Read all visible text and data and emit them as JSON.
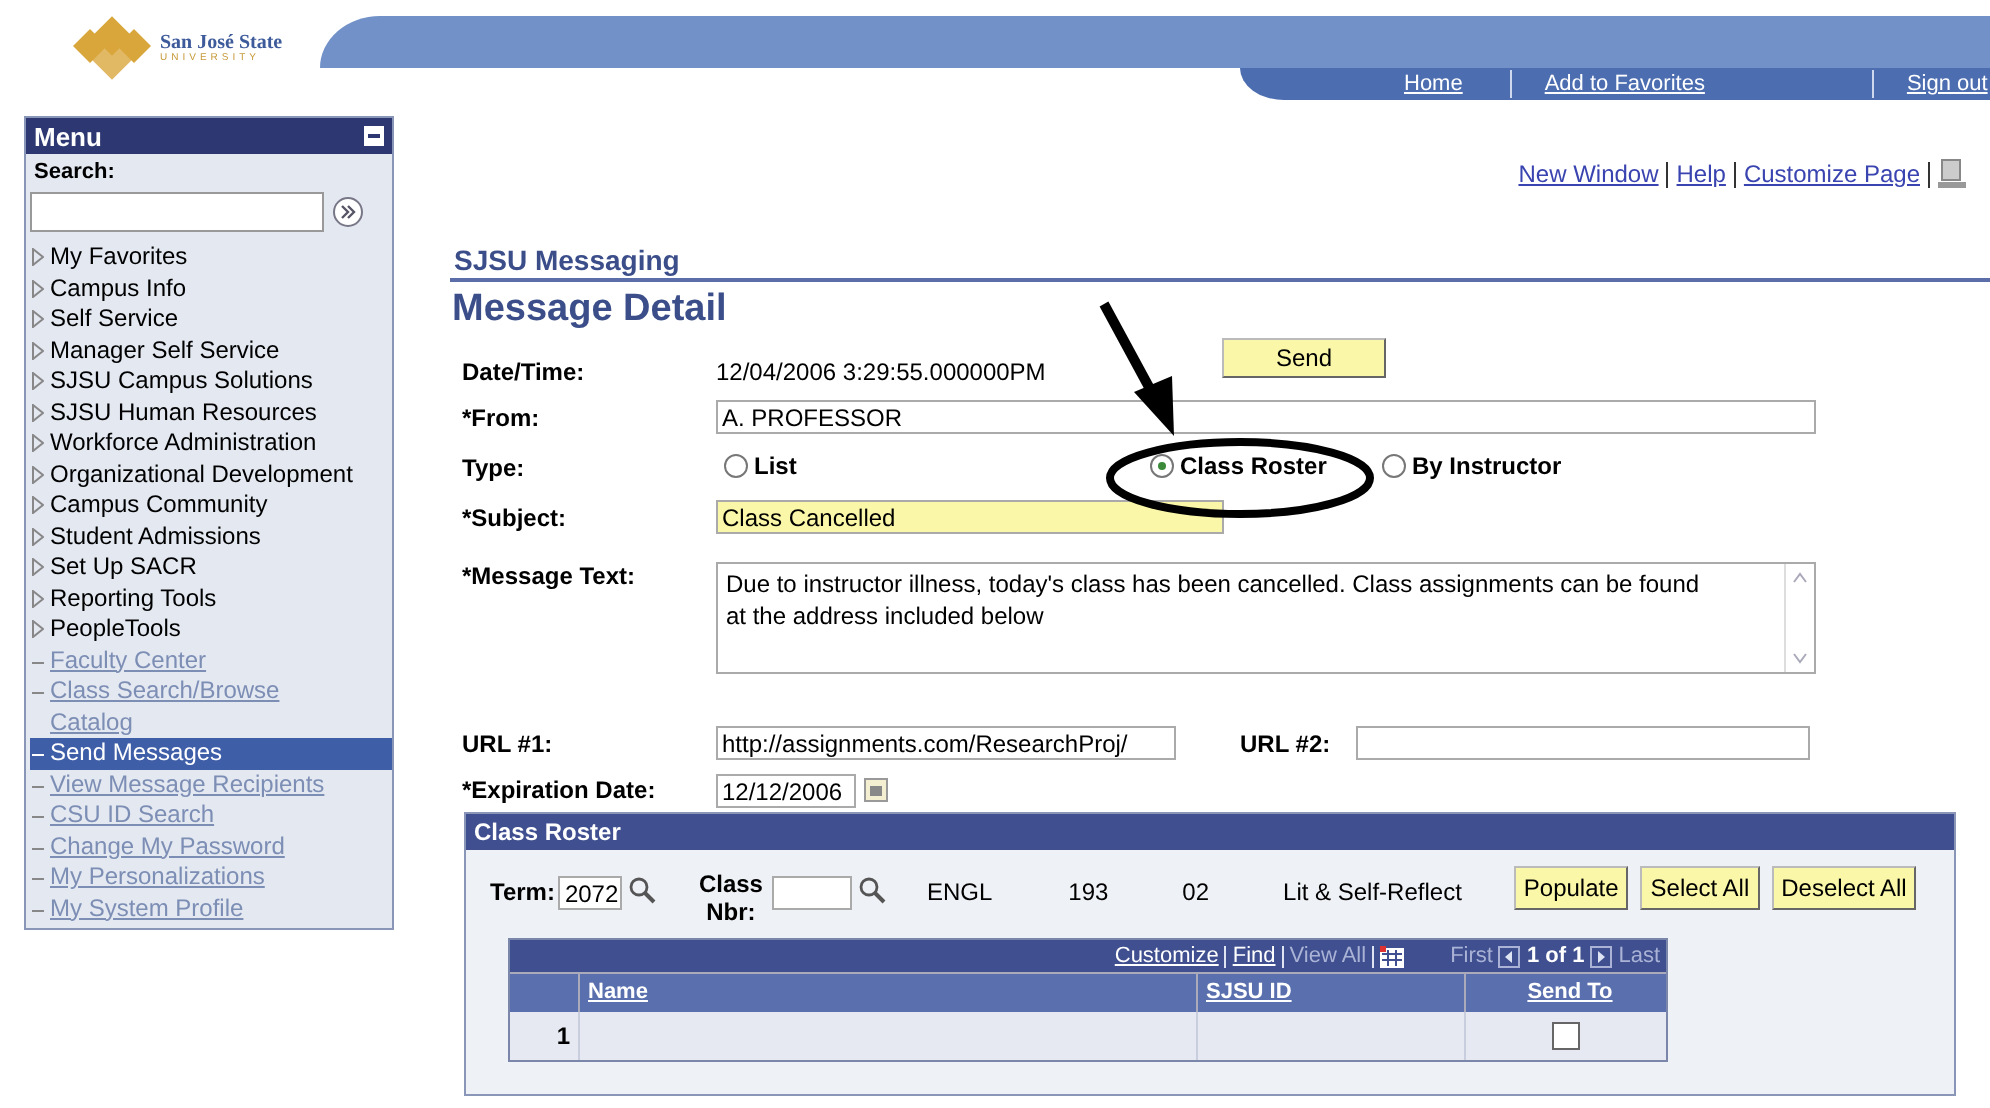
{
  "header": {
    "logo": {
      "name": "San José State",
      "subtitle": "UNIVERSITY"
    },
    "nav_links": [
      "Home",
      "Add to Favorites",
      "Sign out"
    ]
  },
  "menu": {
    "title": "Menu",
    "search_label": "Search:",
    "items": [
      {
        "label": "My Favorites",
        "kind": "folder",
        "selected": false
      },
      {
        "label": "Campus Info",
        "kind": "folder",
        "selected": false
      },
      {
        "label": "Self Service",
        "kind": "folder",
        "selected": false
      },
      {
        "label": "Manager Self Service",
        "kind": "folder",
        "selected": false
      },
      {
        "label": "SJSU Campus Solutions",
        "kind": "folder",
        "selected": false
      },
      {
        "label": "SJSU Human Resources",
        "kind": "folder",
        "selected": false
      },
      {
        "label": "Workforce Administration",
        "kind": "folder",
        "selected": false
      },
      {
        "label": "Organizational Development",
        "kind": "folder",
        "selected": false
      },
      {
        "label": "Campus Community",
        "kind": "folder",
        "selected": false
      },
      {
        "label": "Student Admissions",
        "kind": "folder",
        "selected": false
      },
      {
        "label": "Set Up SACR",
        "kind": "folder",
        "selected": false
      },
      {
        "label": "Reporting Tools",
        "kind": "folder",
        "selected": false
      },
      {
        "label": "PeopleTools",
        "kind": "folder",
        "selected": false
      },
      {
        "label": "Faculty Center",
        "kind": "link",
        "selected": false
      },
      {
        "label": "Class Search/Browse\nCatalog",
        "kind": "link",
        "selected": false
      },
      {
        "label": "Send Messages",
        "kind": "link",
        "selected": true
      },
      {
        "label": "View Message Recipients",
        "kind": "link",
        "selected": false
      },
      {
        "label": "CSU ID Search",
        "kind": "link",
        "selected": false
      },
      {
        "label": "Change My Password",
        "kind": "link",
        "selected": false
      },
      {
        "label": "My Personalizations",
        "kind": "link",
        "selected": false
      },
      {
        "label": "My System Profile",
        "kind": "link",
        "selected": false
      }
    ]
  },
  "page_links": [
    "New Window",
    "Help",
    "Customize Page"
  ],
  "section_title": "SJSU Messaging",
  "heading": "Message Detail",
  "form": {
    "datetime": {
      "label": "Date/Time:",
      "value": "12/04/2006  3:29:55.000000PM"
    },
    "send_button": "Send",
    "from": {
      "label": "*From:",
      "value": "A. PROFESSOR"
    },
    "type": {
      "label": "Type:",
      "options": [
        {
          "label": "List",
          "selected": false
        },
        {
          "label": "Class Roster",
          "selected": true
        },
        {
          "label": "By Instructor",
          "selected": false
        }
      ]
    },
    "subject": {
      "label": "*Subject:",
      "value": "Class Cancelled"
    },
    "message": {
      "label": "*Message Text:",
      "value": "Due to instructor illness, today's class has been cancelled.  Class assignments can be found at the address included below"
    },
    "url1": {
      "label": "URL #1:",
      "value": "http://assignments.com/ResearchProj/"
    },
    "url2": {
      "label": "URL #2:"
    },
    "expiration": {
      "label": "*Expiration Date:",
      "value": "12/12/2006"
    }
  },
  "class_roster": {
    "title": "Class Roster",
    "term_label": "Term:",
    "term_value": "2072",
    "class_nbr_label": "Class Nbr:",
    "subject": "ENGL",
    "catalog": "193",
    "section": "02",
    "description": "Lit & Self-Reflect",
    "buttons": [
      "Populate",
      "Select All",
      "Deselect All"
    ],
    "grid": {
      "links": [
        "Customize",
        "Find"
      ],
      "view_all": "View All",
      "first": "First",
      "page": "1 of 1",
      "last": "Last",
      "columns": [
        "Name",
        "SJSU ID",
        "Send To"
      ],
      "rows": [
        {
          "number": "1",
          "send_to": false
        }
      ]
    }
  }
}
